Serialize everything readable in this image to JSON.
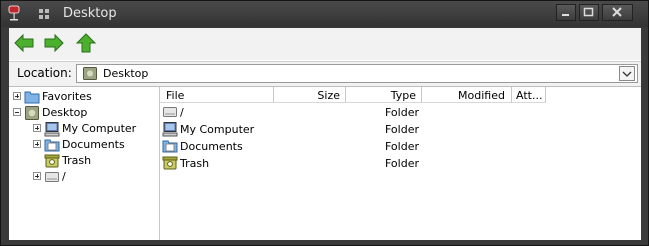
{
  "window": {
    "title": "Desktop"
  },
  "location": {
    "label": "Location:",
    "value": "Desktop"
  },
  "tree": [
    {
      "label": "Favorites",
      "expander": "plus",
      "icon": "folder-blue-icon"
    },
    {
      "label": "Desktop",
      "expander": "minus",
      "icon": "desktop-icon"
    },
    {
      "label": "My Computer",
      "expander": "plus",
      "icon": "computer-icon"
    },
    {
      "label": "Documents",
      "expander": "plus",
      "icon": "documents-icon"
    },
    {
      "label": "Trash",
      "expander": "",
      "icon": "trash-icon"
    },
    {
      "label": "/",
      "expander": "plus",
      "icon": "drive-icon"
    }
  ],
  "columns": {
    "file": "File",
    "size": "Size",
    "type": "Type",
    "modified": "Modified",
    "attr": "Att..."
  },
  "files": [
    {
      "name": "/",
      "size": "",
      "type": "Folder",
      "modified": "",
      "icon": "drive-icon"
    },
    {
      "name": "My Computer",
      "size": "",
      "type": "Folder",
      "modified": "",
      "icon": "computer-icon"
    },
    {
      "name": "Documents",
      "size": "",
      "type": "Folder",
      "modified": "",
      "icon": "documents-icon"
    },
    {
      "name": "Trash",
      "size": "",
      "type": "Folder",
      "modified": "",
      "icon": "trash-icon"
    }
  ],
  "colors": {
    "accent_arrow": "#3fa12a",
    "titlebar": "#3a3a3a"
  }
}
